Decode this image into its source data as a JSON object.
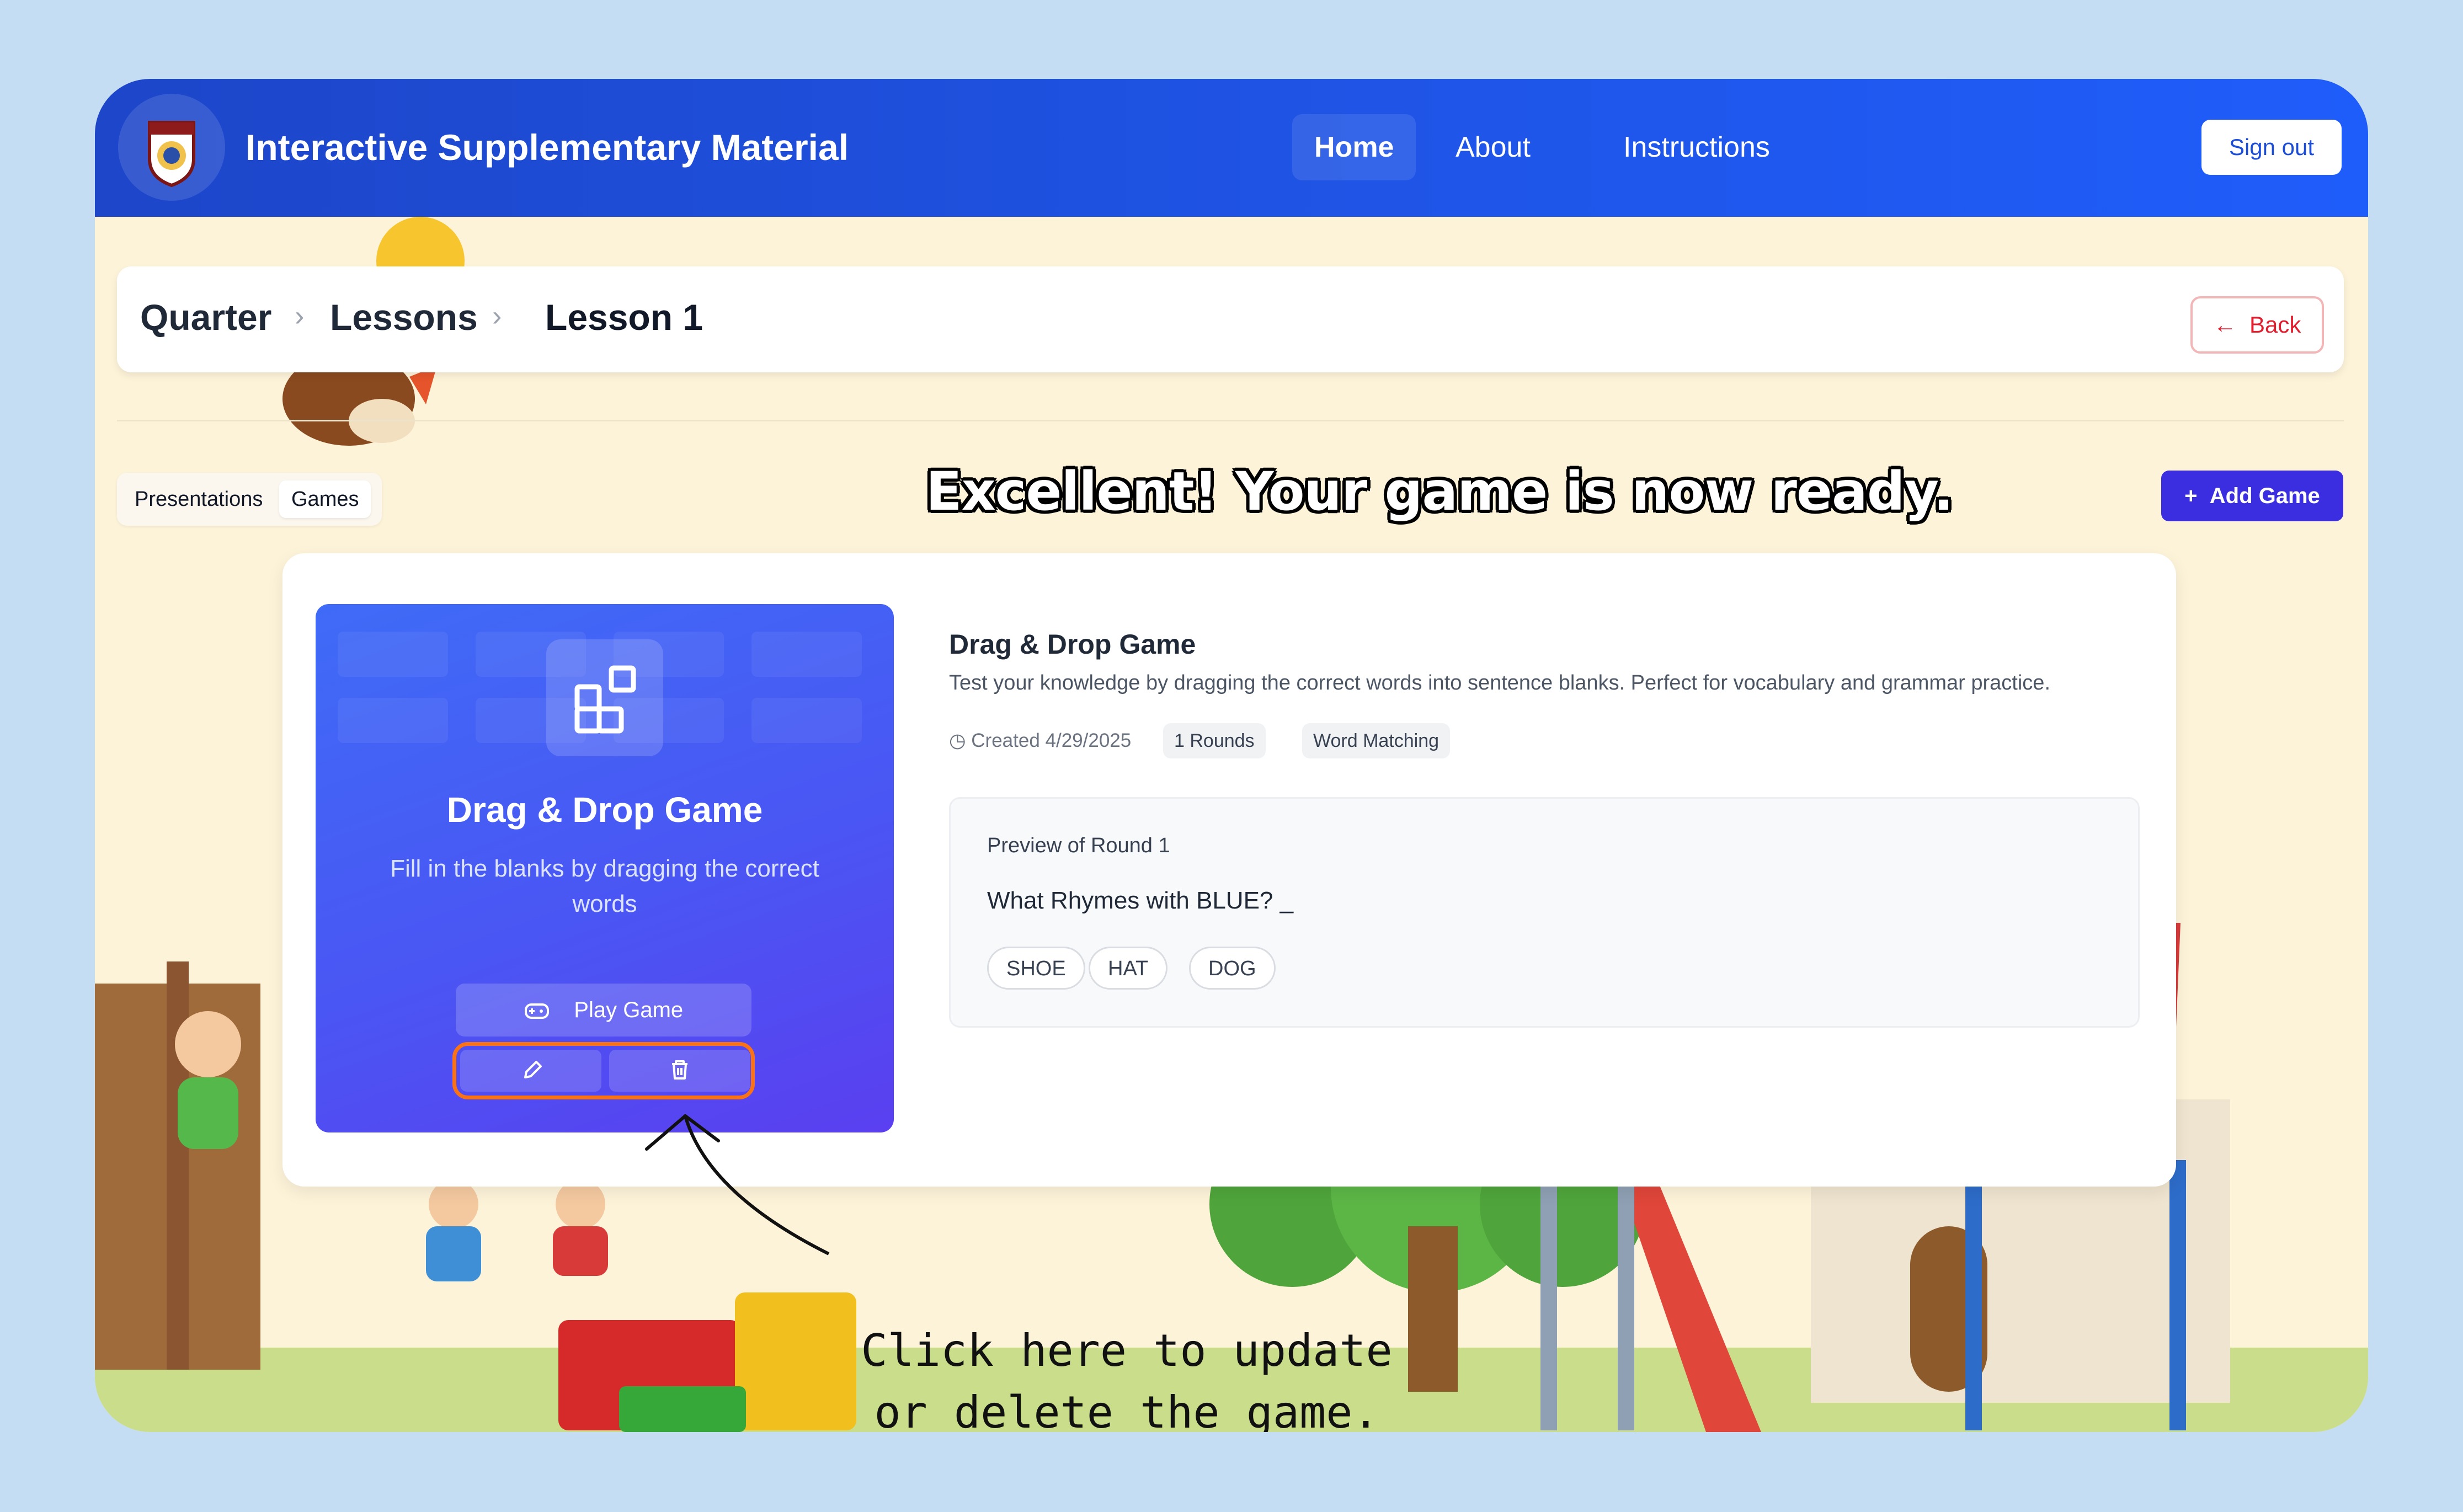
{
  "header": {
    "app_title": "Interactive Supplementary Material",
    "nav": [
      "Home",
      "About",
      "Instructions"
    ],
    "sign_out": "Sign out"
  },
  "breadcrumb": [
    "Quarter",
    "Lessons",
    "Lesson 1"
  ],
  "back_label": "Back",
  "tabs": [
    "Presentations",
    "Games"
  ],
  "add_game_label": "Add Game",
  "headline": "Excellent! Your game is now ready.",
  "game_card": {
    "title": "Drag & Drop Game",
    "description": "Fill in the blanks by dragging the correct words",
    "play_label": "Play Game"
  },
  "details": {
    "title": "Drag & Drop Game",
    "description": "Test your knowledge by dragging the correct words into sentence blanks. Perfect for vocabulary and grammar practice.",
    "created": "Created 4/29/2025",
    "rounds": "1 Rounds",
    "type": "Word Matching"
  },
  "preview": {
    "label": "Preview of Round 1",
    "question": "What Rhymes with BLUE? _",
    "options": [
      "SHOE",
      "HAT",
      "DOG"
    ]
  },
  "annotation": "Click here to update or delete the game.",
  "colors": {
    "header": "#1f55e8",
    "accent": "#3b2ee0",
    "highlight": "#f97316",
    "back": "#e11d2e"
  }
}
